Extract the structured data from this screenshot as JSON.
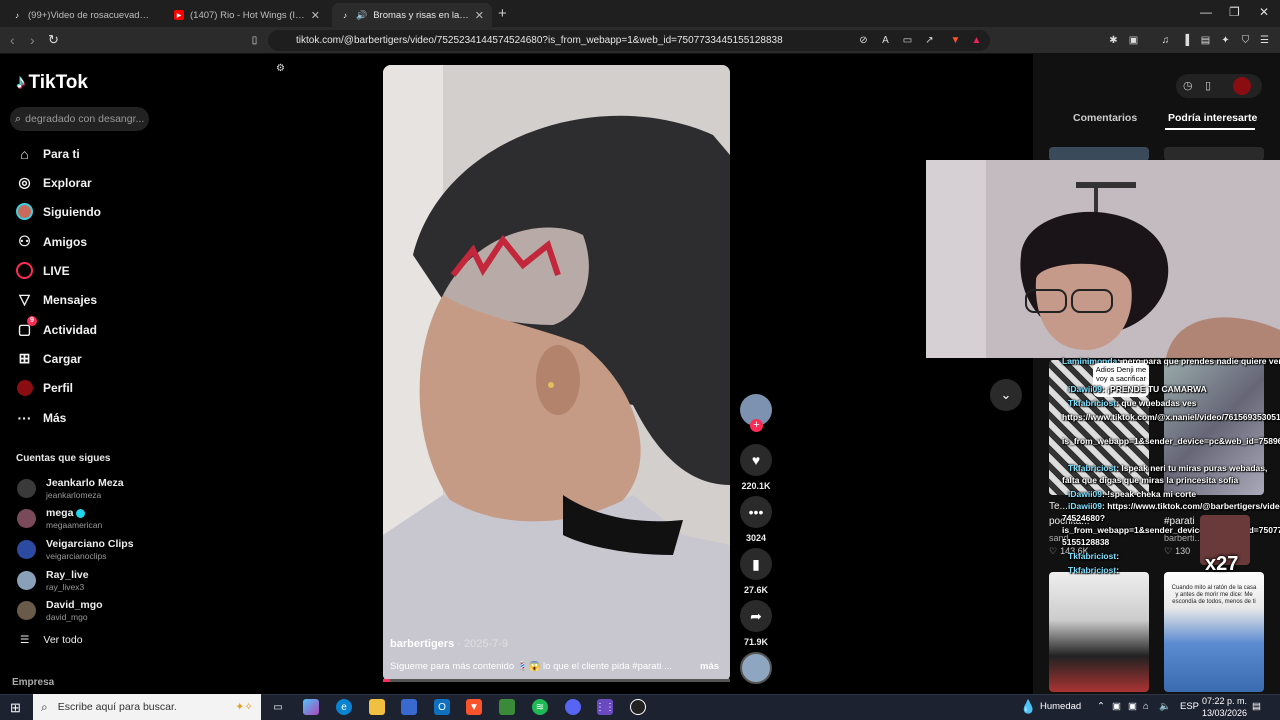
{
  "browser": {
    "tabs": [
      {
        "title": "(99+)Video de rosacuevadechaves (@",
        "icon": "tiktok-icon"
      },
      {
        "title": "(1407) Rio - Hot Wings (I Wa",
        "icon": "youtube-icon"
      },
      {
        "title": "Bromas y risas en la barbería",
        "icon": "tiktok-icon"
      }
    ],
    "url": "tiktok.com/@barbertigers/video/7525234144574524680?is_from_webapp=1&web_id=7507733445155128838"
  },
  "sidebar": {
    "logo": "TikTok",
    "search_placeholder": "degradado con desangr...",
    "nav": [
      {
        "label": "Para ti",
        "icon": "home-icon"
      },
      {
        "label": "Explorar",
        "icon": "compass-icon"
      },
      {
        "label": "Siguiendo",
        "icon": "avatar-icon"
      },
      {
        "label": "Amigos",
        "icon": "friends-icon"
      },
      {
        "label": "LIVE",
        "icon": "live-icon"
      },
      {
        "label": "Mensajes",
        "icon": "send-icon"
      },
      {
        "label": "Actividad",
        "icon": "inbox-icon",
        "badge": "9"
      },
      {
        "label": "Cargar",
        "icon": "upload-icon"
      },
      {
        "label": "Perfil",
        "icon": "profile-icon"
      },
      {
        "label": "Más",
        "icon": "more-icon"
      }
    ],
    "following_title": "Cuentas que sigues",
    "accounts": [
      {
        "name": "Jeankarlo Meza",
        "handle": "jeankarlomeza",
        "color": "#3a3a3a"
      },
      {
        "name": "mega",
        "handle": "megaamerican",
        "color": "#7a4a5a",
        "verified": true
      },
      {
        "name": "Veigarciano Clips",
        "handle": "veigarcianoclips",
        "color": "#2b4aa0"
      },
      {
        "name": "Ray_live",
        "handle": "ray_livex3",
        "color": "#8aa0b8"
      },
      {
        "name": "David_mgo",
        "handle": "david_mgo",
        "color": "#6a5a4a"
      }
    ],
    "see_all": "Ver todo",
    "empresa": "Empresa"
  },
  "video": {
    "author": "barbertigers",
    "date": "2025-7-9",
    "caption": "Sígueme para más contenido 💈😱 lo que el cliente pida #parati ...",
    "more": "más",
    "progress": 0.02,
    "actions": {
      "likes": "220.1K",
      "comments": "3024",
      "saves": "27.6K",
      "shares": "71.9K"
    }
  },
  "right_panel": {
    "tabs": [
      "Comentarios",
      "Podría interesarte"
    ],
    "cards": [
      {
        "title": "Te...",
        "title2": "pochita...",
        "author": "sand...",
        "likes": "143.6K"
      },
      {
        "title": "#parati",
        "author": "barberti...",
        "likes": "130"
      }
    ]
  },
  "stream_overlay": {
    "chat": [
      {
        "user": "Laminimonda",
        "text": ": pero para que prendes nadie quiere verte"
      },
      {
        "user": "Adios Denji",
        "text": " me voy a sacrificar por ...",
        "bubble": true
      },
      {
        "user": "iDawii09",
        "text": ": ¡PRENDE TU CAMARWA"
      },
      {
        "user": "Tkfabriciost",
        "text": ": que wuebadas ves"
      },
      {
        "user": "",
        "text": "https://www.tiktok.com/@x.naniel/video/7615693530519"
      },
      {
        "user": "",
        "text": "is_from_webapp=1&sender_device=pc&web_id=758969766"
      },
      {
        "user": "Tkfabriciost",
        "text": ": Ispeak neri tu miras puras webadas,"
      },
      {
        "user": "",
        "text": "falta que digas que miras la princesita sofia"
      },
      {
        "user": "iDawii09",
        "text": ": !speak cheka mi corte"
      },
      {
        "user": "iDawii09",
        "text": ": https://www.tiktok.com/@barbertigers/video/75252341445"
      },
      {
        "user": "",
        "text": "74524680?"
      },
      {
        "user": "",
        "text": "is_from_webapp=1&sender_device=pc&web_id=7507733445"
      },
      {
        "user": "",
        "text": "5155128838"
      },
      {
        "user": "Tkfabriciost",
        "text": ":"
      },
      {
        "user": "Tkfabriciost",
        "text": ":"
      }
    ],
    "combo": "x27",
    "thumb_caption": "Cuando mito al ratón de la casa y antes de morir me dice: Me escondía de todos, menos de ti"
  },
  "taskbar": {
    "search_placeholder": "Escribe aquí para buscar.",
    "weather": "Humedad",
    "lang": "ESP",
    "time": "07:22 p. m.",
    "date": "13/03/2026"
  }
}
